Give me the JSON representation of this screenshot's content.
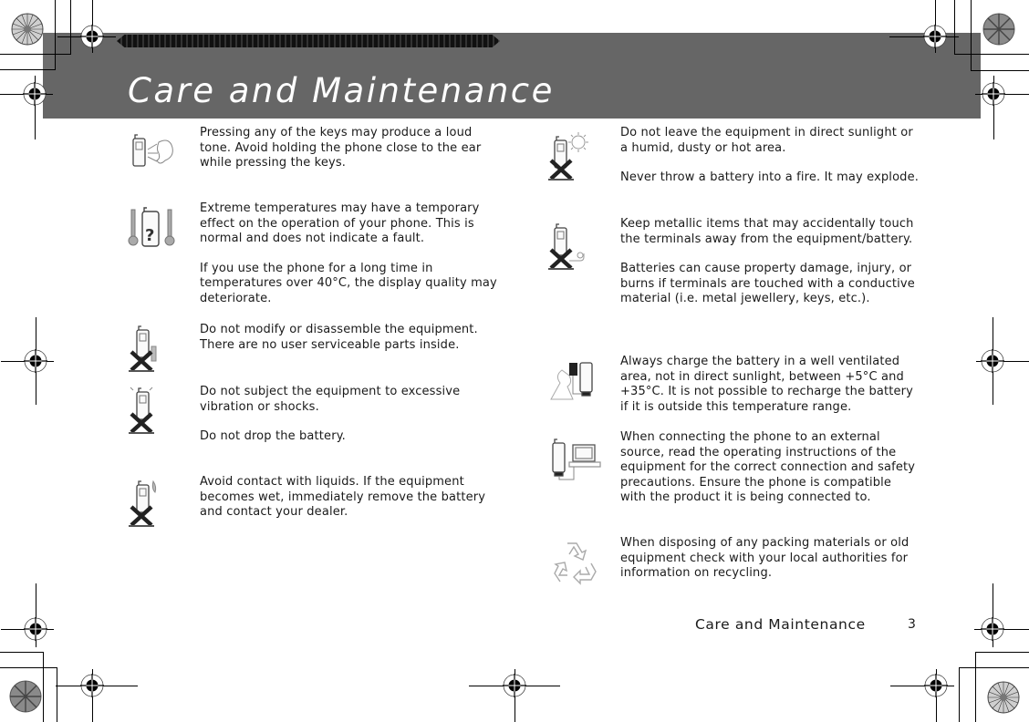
{
  "header": {
    "title": "Care and Maintenance"
  },
  "left_column": [
    {
      "icon": "phone-loud-tone-icon",
      "paragraphs": [
        "Pressing any of the keys may produce a loud tone. Avoid holding the phone close to the ear while pressing the keys."
      ]
    },
    {
      "icon": "phone-thermometer-icon",
      "paragraphs": [
        "Extreme temperatures may have a temporary effect on the operation of your phone. This is normal and does not indicate a fault.",
        "If you use the phone for a long time in temperatures over 40°C, the display quality may deteriorate."
      ]
    },
    {
      "icon": "no-disassemble-icon",
      "paragraphs": [
        "Do not modify or disassemble the equipment. There are no user serviceable parts inside."
      ]
    },
    {
      "icon": "no-shock-icon",
      "paragraphs": [
        "Do not subject the equipment to excessive vibration or shocks.",
        "Do not drop the battery."
      ]
    },
    {
      "icon": "no-liquid-icon",
      "paragraphs": [
        "Avoid contact with liquids. If the equipment becomes wet, immediately remove the battery and contact your dealer."
      ]
    }
  ],
  "right_column": [
    {
      "icon": "no-sunlight-icon",
      "paragraphs": [
        "Do not leave the equipment in direct sunlight or a humid, dusty or hot area.",
        "Never throw a battery into a fire. It may explode."
      ]
    },
    {
      "icon": "no-metal-contact-icon",
      "paragraphs": [
        "Keep metallic items that may accidentally touch the terminals away from the equipment/battery.",
        "Batteries can cause property damage, injury, or burns if terminals are touched with a conductive material (i.e. metal jewellery, keys, etc.)."
      ]
    },
    {
      "icon": "charger-icon",
      "paragraphs": [
        "Always charge the battery in a well ventilated area, not in direct sunlight, between +5°C and +35°C. It is not possible to recharge the battery if it is outside this temperature range."
      ]
    },
    {
      "icon": "external-connection-icon",
      "paragraphs": [
        "When connecting the phone to an external source, read the operating instructions of the equipment for the correct connection and safety precautions. Ensure the phone is compatible with the product it is being connected to."
      ]
    },
    {
      "icon": "recycle-icon",
      "paragraphs": [
        "When disposing of any packing materials or old equipment check with your local authorities for information on recycling."
      ]
    }
  ],
  "footer": {
    "section_title": "Care and Maintenance",
    "page_number": "3"
  },
  "colors": {
    "header_band": "#666666",
    "title_text": "#ffffff",
    "body_text": "#1a1a1a"
  }
}
